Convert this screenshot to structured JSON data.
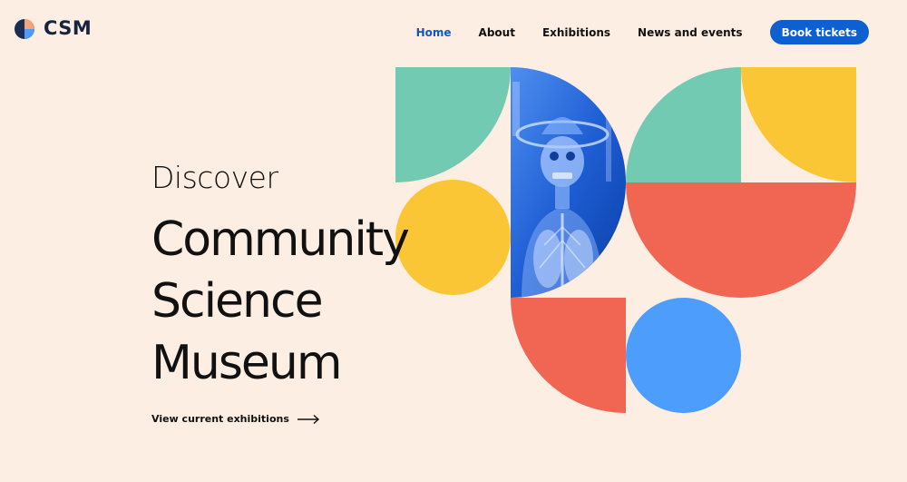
{
  "brand": {
    "logo_text": "CSM"
  },
  "nav": {
    "items": [
      {
        "label": "Home",
        "active": true
      },
      {
        "label": "About",
        "active": false
      },
      {
        "label": "Exhibitions",
        "active": false
      },
      {
        "label": "News and events",
        "active": false
      }
    ],
    "book_label": "Book tickets"
  },
  "hero": {
    "kicker": "Discover",
    "headline_lines": [
      "Community",
      "Science",
      "Museum"
    ],
    "cta_label": "View current exhibitions"
  },
  "colors": {
    "background": "#fdeee3",
    "accent_blue": "#0e5fd0",
    "teal": "#72cab3",
    "yellow": "#fbc636",
    "red": "#f06653",
    "light_blue": "#4d9efc",
    "photo_blue": "#2f6ed8"
  },
  "icons": {
    "logo": "csm-logo-icon",
    "cta_arrow": "arrow-right-icon",
    "photo": "skeleton-model-photo"
  }
}
